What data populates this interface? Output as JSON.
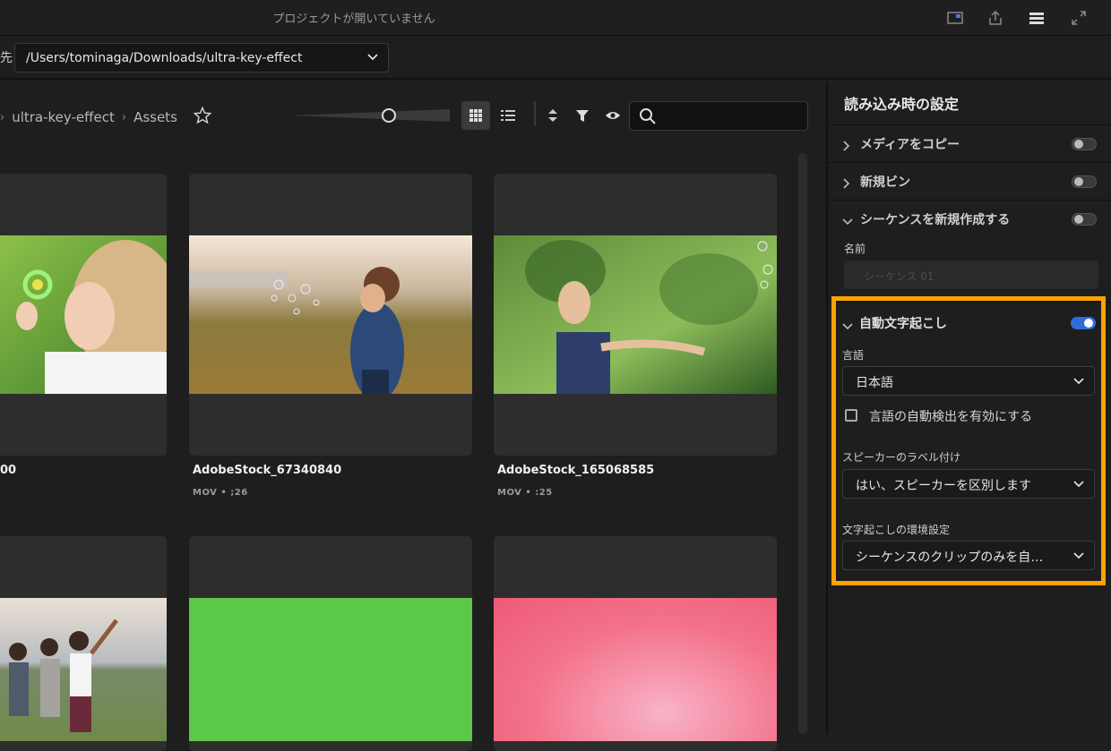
{
  "titlebar": {
    "title": "プロジェクトが開いていません"
  },
  "pathbar": {
    "cut_label": "先",
    "path": "/Users/tominaga/Downloads/ultra-key-effect"
  },
  "breadcrumb": {
    "prefix": "›",
    "folder": "ultra-key-effect",
    "sep": "›",
    "current": "Assets"
  },
  "search": {
    "placeholder": ""
  },
  "assets": [
    {
      "name": "00",
      "meta": ""
    },
    {
      "name": "AdobeStock_67340840",
      "meta": "MOV • ;26"
    },
    {
      "name": "AdobeStock_165068585",
      "meta": "MOV • :25"
    }
  ],
  "settings": {
    "title": "読み込み時の設定",
    "copy_media": {
      "label": "メディアをコピー",
      "on": false
    },
    "new_bin": {
      "label": "新規ビン",
      "on": false
    },
    "new_sequence": {
      "label": "シーケンスを新規作成する",
      "on": false,
      "name_label": "名前",
      "name_placeholder": "シーケンス 01"
    },
    "auto_transcribe": {
      "label": "自動文字起こし",
      "on": true,
      "language_label": "言語",
      "language_value": "日本語",
      "autodetect_label": "言語の自動検出を有効にする",
      "speaker_label": "スピーカーのラベル付け",
      "speaker_value": "はい、スピーカーを区別します",
      "pref_label": "文字起こしの環境設定",
      "pref_value": "シーケンスのクリップのみを自…"
    }
  },
  "colors": {
    "accent": "#ffa200",
    "toggle_on": "#2f6cd9"
  }
}
